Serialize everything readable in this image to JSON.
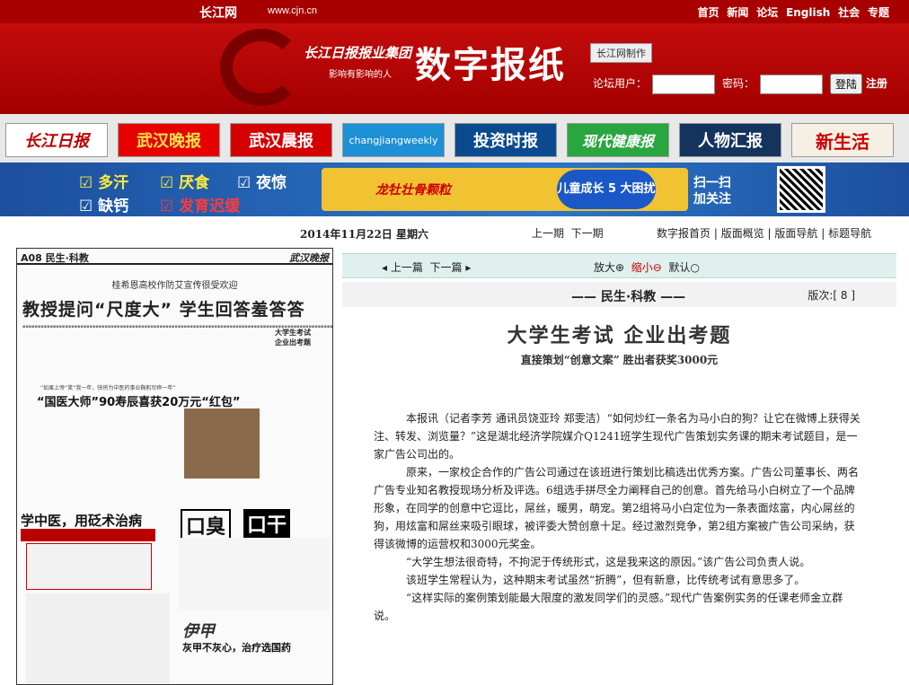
{
  "topbar": {
    "logo": "长江网",
    "url": "www.cjn.cn",
    "nav": [
      "首页",
      "新闻",
      "论坛",
      "English",
      "社会",
      "专题"
    ]
  },
  "banner": {
    "group": "长江日报报业集团",
    "slogan": "影响有影响的人",
    "title": "数字报纸",
    "made_by": "长江网制作",
    "user_label": "论坛用户：",
    "password_label": "密码：",
    "login_button": "登陆",
    "register": "注册"
  },
  "publications": [
    "长江日报",
    "武汉晚报",
    "武汉晨报",
    "changjiangweekly",
    "投资时报",
    "现代健康报",
    "人物汇报",
    "新生活"
  ],
  "ad": {
    "items": [
      "多汗",
      "厌食",
      "夜惊",
      "缺钙",
      "发育迟缓"
    ],
    "product": "龙牡壮骨颗粒",
    "campaign": "儿童成长 5 大困扰",
    "scan_text": [
      "扫一扫",
      "加关注"
    ]
  },
  "datebar": {
    "date": "2014年11月22日  星期六",
    "prev_issue": "上一期",
    "next_issue": "下一期",
    "links": [
      "数字报首页",
      "版面概览",
      "版面导航",
      "标题导航"
    ]
  },
  "thumbnail": {
    "page_label": "A08 民生·科教",
    "brand": "武汉晚报",
    "kicker": "桂希恩高校作防艾宣传很受欢迎",
    "headline": "教授提问“尺度大” 学生回答羞答答",
    "box_title": [
      "大学生考试",
      "企业出考题"
    ],
    "sub_headline": "“国医大师”90寿辰喜获20万元“红包”",
    "sub_kicker": "“如果上帝”笑“我一年，快将为中医药事业鞠躬尽瘁一年”",
    "ad1": "学中医，用砭术治病",
    "ad2": "口臭",
    "ad3": "口干",
    "ad4": "伊甲",
    "ad4_sub": "灰甲不灰心，治疗选国药"
  },
  "article_nav": {
    "prev": "上一篇",
    "next": "下一篇",
    "zoom_in": "放大",
    "zoom_out": "缩小",
    "default": "默认"
  },
  "section": {
    "name": "—— 民生·科教 ——",
    "version_label": "版次:",
    "version": "8"
  },
  "article": {
    "title": "大学生考试  企业出考题",
    "subtitle": "直接策划“创意文案”  胜出者获奖3000元",
    "paragraphs": [
      "本报讯（记者李芳 通讯员饶亚玲 郑雯洁）“如何炒红一条名为马小白的狗？让它在微博上获得关注、转发、浏览量？”这是湖北经济学院媒介Q1241班学生现代广告策划实务课的期末考试题目，是一家广告公司出的。",
      "原来，一家校企合作的广告公司通过在该班进行策划比稿选出优秀方案。广告公司董事长、两名广告专业知名教授现场分析及评选。6组选手拼尽全力阐释自己的创意。首先给马小白树立了一个品牌形象，在同学的创意中它逗比，屌丝，暖男，萌宠。第2组将马小白定位为一条表面炫富，内心屌丝的狗，用炫富和屌丝来吸引眼球，被评委大赞创意十足。经过激烈竞争，第2组方案被广告公司采纳，获得该微博的运营权和3000元奖金。",
      "“大学生想法很奇特，不拘泥于传统形式，这是我来这的原因。”该广告公司负责人说。",
      "该班学生常程认为，这种期末考试虽然“折腾”，但有新意，比传统考试有意思多了。",
      "“这样实际的案例策划能最大限度的激发同学们的灵感。”现代广告案例实务的任课老师金立群说。"
    ]
  },
  "colors": {
    "brand_red": "#a80000",
    "nav_teal": "#dff0ee",
    "ad_blue": "#2b76c8"
  }
}
